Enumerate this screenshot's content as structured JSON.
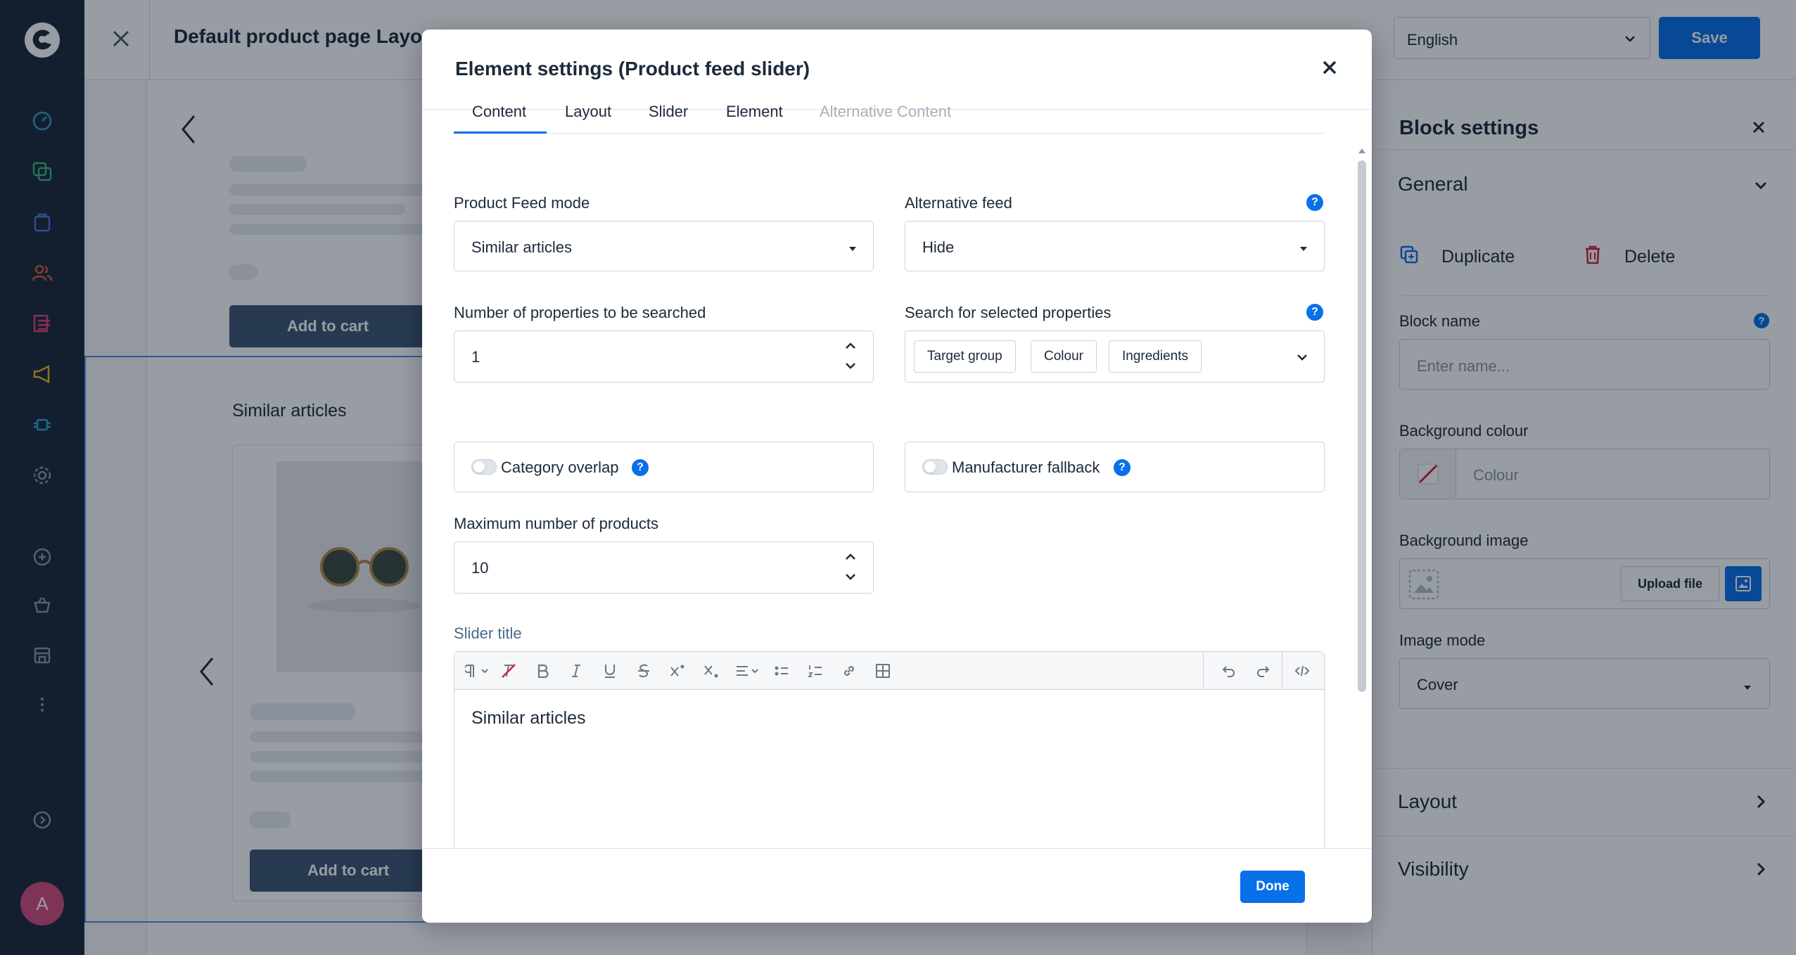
{
  "nav": {
    "avatar_initial": "A",
    "icons": [
      "dashboard-icon",
      "catalogue-icon",
      "orders-icon",
      "customers-icon",
      "content-icon",
      "marketing-icon",
      "extensions-icon",
      "settings-icon",
      "add-icon",
      "store-icon",
      "storefront-icon",
      "more-icon",
      "expand-icon"
    ]
  },
  "topbar": {
    "title": "Default product page Layout",
    "language": "English",
    "save_label": "Save"
  },
  "preview": {
    "add_to_cart_1": "Add to cart",
    "add_to_cart_2": "Add to cart",
    "section_title": "Similar articles"
  },
  "block_settings": {
    "title": "Block settings",
    "general_label": "General",
    "duplicate_label": "Duplicate",
    "delete_label": "Delete",
    "block_name_label": "Block name",
    "block_name_placeholder": "Enter name...",
    "bg_colour_label": "Background colour",
    "bg_colour_placeholder": "Colour",
    "bg_image_label": "Background image",
    "upload_label": "Upload file",
    "image_mode_label": "Image mode",
    "image_mode_value": "Cover",
    "layout_label": "Layout",
    "visibility_label": "Visibility"
  },
  "modal": {
    "title": "Element settings (Product feed slider)",
    "tabs": [
      {
        "label": "Content",
        "active": true
      },
      {
        "label": "Layout",
        "active": false
      },
      {
        "label": "Slider",
        "active": false
      },
      {
        "label": "Element",
        "active": false
      },
      {
        "label": "Alternative Content",
        "disabled": true
      }
    ],
    "product_feed_mode_label": "Product Feed mode",
    "product_feed_mode_value": "Similar articles",
    "alternative_feed_label": "Alternative feed",
    "alternative_feed_value": "Hide",
    "num_properties_label": "Number of properties to be searched",
    "num_properties_value": "1",
    "search_props_label": "Search for selected properties",
    "search_props_chips": [
      "Target group",
      "Colour",
      "Ingredients"
    ],
    "category_overlap_label": "Category overlap",
    "manufacturer_fallback_label": "Manufacturer fallback",
    "max_products_label": "Maximum number of products",
    "max_products_value": "10",
    "slider_title_label": "Slider title",
    "slider_title_content": "Similar articles",
    "done_label": "Done",
    "help_glyph": "?"
  },
  "colors": {
    "accent": "#0870e8",
    "nav_bg": "#1b2838",
    "avatar": "#d44a7c",
    "cart_button": "#3d5673"
  }
}
